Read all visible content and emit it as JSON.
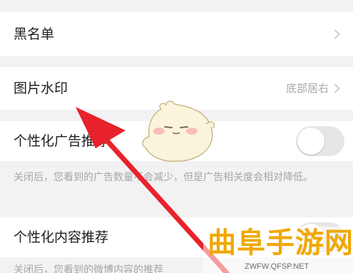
{
  "settings": {
    "blacklist": {
      "label": "黑名单"
    },
    "image_watermark": {
      "label": "图片水印",
      "value": "底部居右"
    },
    "personalized_ads": {
      "label": "个性化广告推荐",
      "enabled": false,
      "description": "关闭后，您看到的广告数量不会减少，但是广告相关度会相对降低。"
    },
    "personalized_content": {
      "label": "个性化内容推荐",
      "enabled": false,
      "description": "关闭后，您看到的微博内容的推荐"
    }
  },
  "overlay": {
    "arrow_color": "#e8222a",
    "mascot_icon": "chick-mascot-icon"
  },
  "watermark": {
    "title": "曲阜手游网",
    "url": "ZWFW.QFSP.NET",
    "color": "#f0a800"
  }
}
